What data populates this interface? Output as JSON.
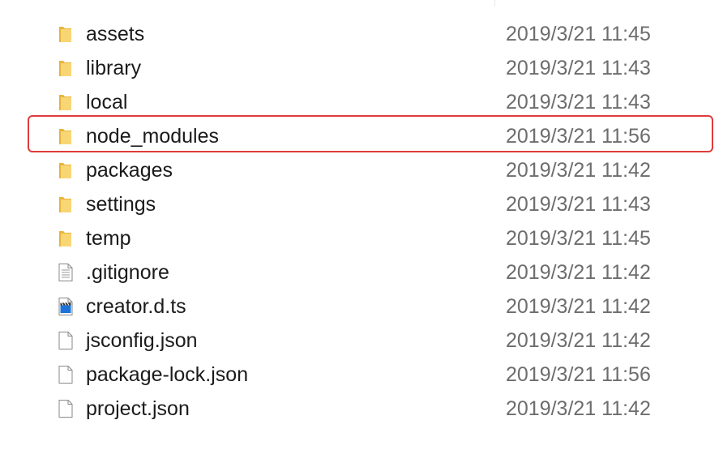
{
  "files": [
    {
      "name": "assets",
      "date": "2019/3/21 11:45",
      "icon": "folder-icon"
    },
    {
      "name": "library",
      "date": "2019/3/21 11:43",
      "icon": "folder-icon"
    },
    {
      "name": "local",
      "date": "2019/3/21 11:43",
      "icon": "folder-icon"
    },
    {
      "name": "node_modules",
      "date": "2019/3/21 11:56",
      "icon": "folder-icon"
    },
    {
      "name": "packages",
      "date": "2019/3/21 11:42",
      "icon": "folder-icon"
    },
    {
      "name": "settings",
      "date": "2019/3/21 11:43",
      "icon": "folder-icon"
    },
    {
      "name": "temp",
      "date": "2019/3/21 11:45",
      "icon": "folder-icon"
    },
    {
      "name": ".gitignore",
      "date": "2019/3/21 11:42",
      "icon": "text-file-icon"
    },
    {
      "name": "creator.d.ts",
      "date": "2019/3/21 11:42",
      "icon": "clapperboard-file-icon"
    },
    {
      "name": "jsconfig.json",
      "date": "2019/3/21 11:42",
      "icon": "file-icon"
    },
    {
      "name": "package-lock.json",
      "date": "2019/3/21 11:56",
      "icon": "file-icon"
    },
    {
      "name": "project.json",
      "date": "2019/3/21 11:42",
      "icon": "file-icon"
    }
  ],
  "highlight_color": "#e03b3b",
  "folder_color": "#f5c242"
}
